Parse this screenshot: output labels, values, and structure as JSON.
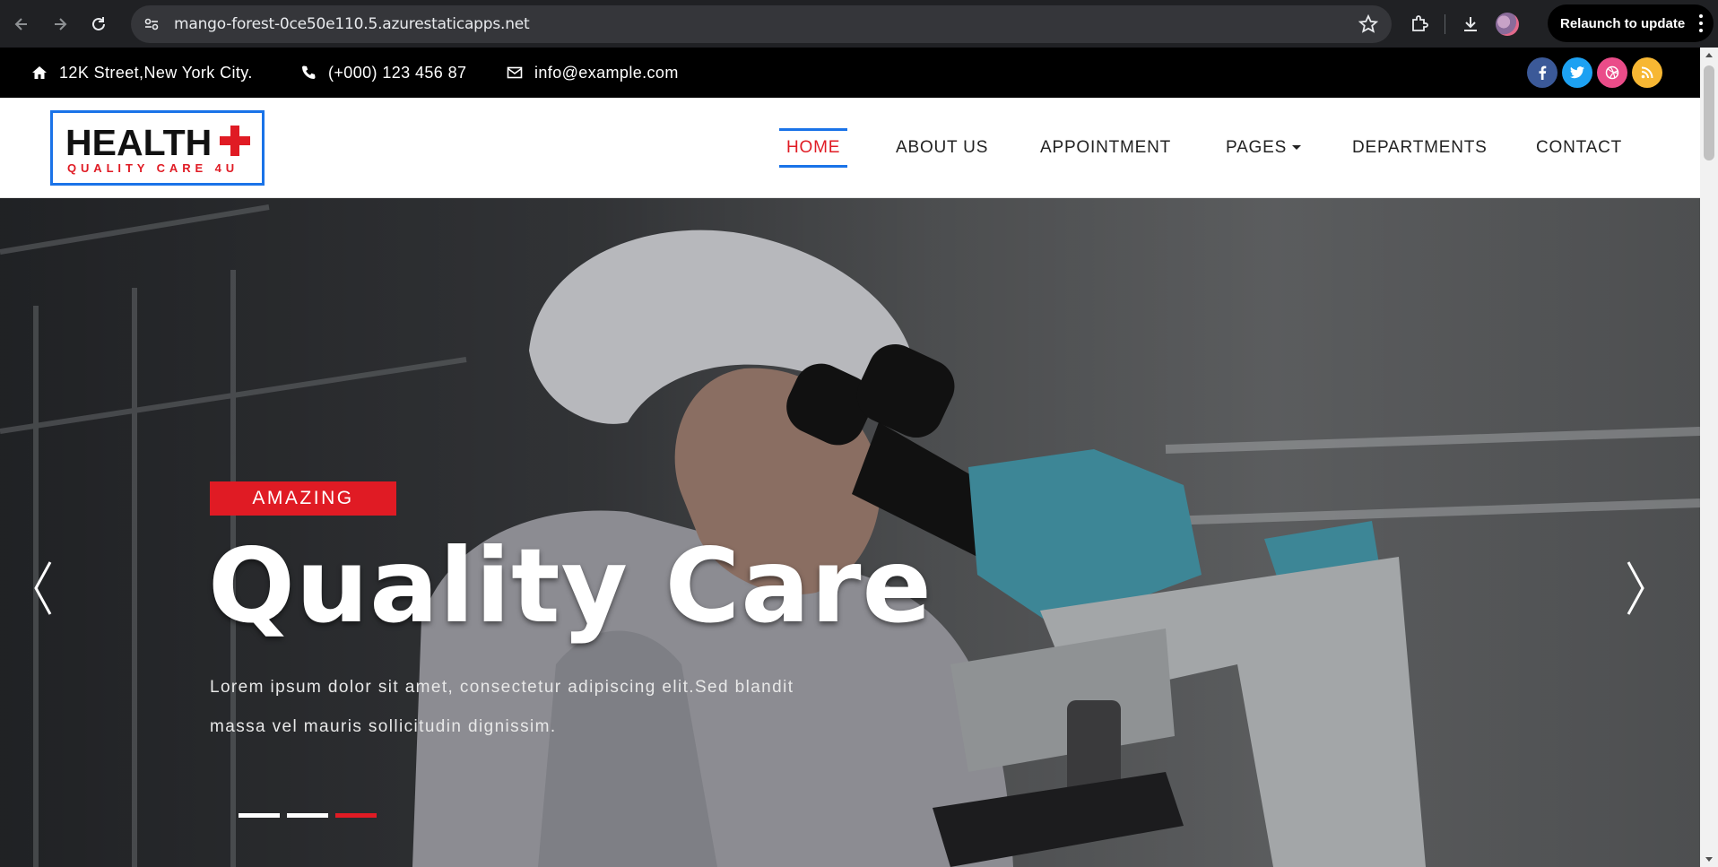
{
  "browser": {
    "url": "mango-forest-0ce50e110.5.azurestaticapps.net",
    "relaunch_label": "Relaunch to update",
    "icons": [
      "back-icon",
      "forward-icon",
      "reload-icon",
      "site-info-icon",
      "bookmark-star-icon",
      "extensions-icon",
      "download-icon",
      "profile-avatar",
      "more-menu-icon"
    ]
  },
  "topbar": {
    "address": "12K Street,New York City.",
    "phone": "(+000) 123 456 87",
    "email": "info@example.com",
    "social": [
      {
        "name": "facebook",
        "glyph": "f",
        "color": "#3b5998"
      },
      {
        "name": "twitter",
        "glyph": "t",
        "color": "#1da1f2"
      },
      {
        "name": "dribbble",
        "glyph": "◎",
        "color": "#ea4c89"
      },
      {
        "name": "rss",
        "glyph": "◉",
        "color": "#f7b733"
      }
    ]
  },
  "logo": {
    "main": "HEALTH",
    "sub": "QUALITY CARE 4U",
    "accent": "#e01b24"
  },
  "nav": {
    "items": [
      {
        "label": "HOME",
        "active": true
      },
      {
        "label": "ABOUT US"
      },
      {
        "label": "APPOINTMENT"
      },
      {
        "label": "PAGES",
        "dropdown": true
      },
      {
        "label": "DEPARTMENTS"
      },
      {
        "label": "CONTACT"
      }
    ],
    "active_color": "#e01b24",
    "active_border_color": "#1a73e8"
  },
  "hero": {
    "badge": "AMAZING",
    "title": "Quality Care",
    "text": "Lorem ipsum dolor sit amet, consectetur adipiscing elit.Sed blandit massa vel mauris sollicitudin dignissim.",
    "slides": 3,
    "active_slide": 3,
    "prev_icon": "chevron-left-icon",
    "next_icon": "chevron-right-icon"
  }
}
